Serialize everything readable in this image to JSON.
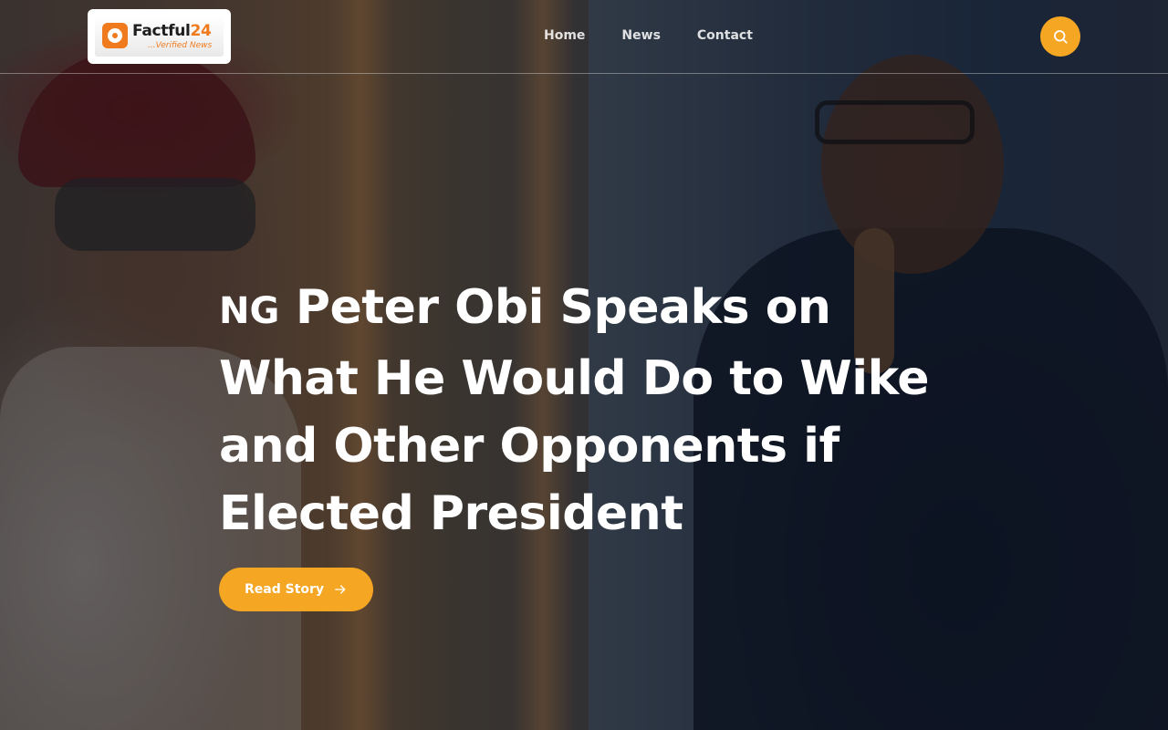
{
  "brand": {
    "name_main": "Factful",
    "name_number": "24",
    "tagline": "...Verified News",
    "accent_color": "#f07a1e"
  },
  "nav": {
    "items": [
      {
        "label": "Home"
      },
      {
        "label": "News"
      },
      {
        "label": "Contact"
      }
    ]
  },
  "search": {
    "icon": "search-icon",
    "button_color": "#f5a623"
  },
  "hero": {
    "flag_prefix": "NG",
    "headline": "Peter Obi Speaks on What He Would Do to Wike and Other Opponents if Elected President",
    "cta_label": "Read Story",
    "cta_icon": "arrow-right-icon",
    "cta_color": "#f5a623"
  }
}
